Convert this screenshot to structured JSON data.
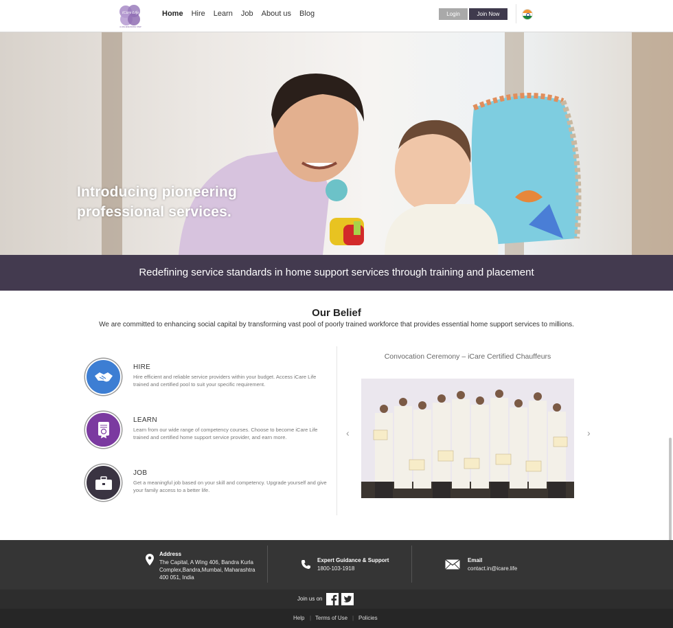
{
  "header": {
    "logo_text": "iCare Life",
    "logo_tagline": "A LIFE ENHANCING STEP",
    "nav": [
      "Home",
      "Hire",
      "Learn",
      "Job",
      "About us",
      "Blog"
    ],
    "login_label": "Login",
    "join_label": "Join Now"
  },
  "hero": {
    "line1": "Introducing pioneering",
    "line2": "professional services."
  },
  "band": {
    "text": "Redefining service standards in home support services through training and placement"
  },
  "belief": {
    "title": "Our Belief",
    "subtitle": "We are committed to enhancing social capital by transforming vast pool of poorly trained workforce that provides essential home support services to millions."
  },
  "features": [
    {
      "title": "HIRE",
      "desc": "Hire efficient and reliable service providers within your budget. Access iCare Life trained and certified pool to suit your specific requirement.",
      "color": "#3d7ed3",
      "icon": "handshake-icon"
    },
    {
      "title": "LEARN",
      "desc": "Learn from our wide range of competency courses. Choose to become iCare Life trained and certified home support service provider, and earn more.",
      "color": "#7b3aa0",
      "icon": "certificate-icon"
    },
    {
      "title": "JOB",
      "desc": "Get a meaningful job based on your skill and competency. Upgrade yourself and give your family access to a better life.",
      "color": "#3a3442",
      "icon": "briefcase-icon"
    }
  ],
  "gallery": {
    "caption": "Convocation Ceremony – iCare Certified Chauffeurs",
    "prev": "‹",
    "next": "›"
  },
  "footer": {
    "address_title": "Address",
    "address_lines": [
      "The Capital, A Wing 406, Bandra Kurla",
      "Complex,Bandra,Mumbai, Maharashtra",
      "400 051, India"
    ],
    "support_title": "Expert Guidance & Support",
    "support_phone": "1800-103-1918",
    "email_title": "Email",
    "email": "contact.in@icare.life",
    "join_us": "Join us on",
    "links": [
      "Help",
      "Terms of Use",
      "Policies"
    ]
  },
  "colors": {
    "brand_dark": "#433a4f",
    "hire": "#3d7ed3",
    "learn": "#7b3aa0",
    "job": "#3a3442"
  }
}
